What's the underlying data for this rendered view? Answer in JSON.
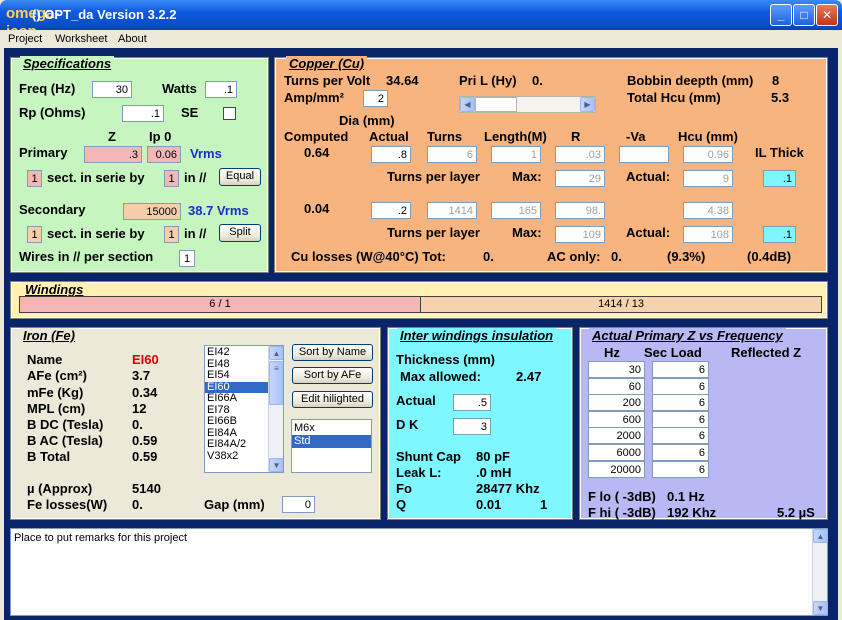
{
  "window": {
    "title": "()  OPT_da Version 3.2.2",
    "icon": "omega-icon",
    "min": "_",
    "max": "□",
    "close": "✕"
  },
  "menu": [
    "Project",
    "Worksheet",
    "About"
  ],
  "spec": {
    "title": "Specifications",
    "freq_label": "Freq (Hz)",
    "freq": "30",
    "watts_label": "Watts",
    "watts": ".1",
    "rp_label": "Rp (Ohms)",
    "rp": ".1",
    "se_label": "SE",
    "z_label": "Z",
    "ip0_label": "Ip 0",
    "primary_label": "Primary",
    "primary_z": ".3",
    "primary_ip": "0.06",
    "primary_vrms": "Vrms",
    "p_sect": "1",
    "sect_text": "sect. in serie by",
    "p_par": "1",
    "in_par": "in //",
    "equal": "Equal",
    "secondary_label": "Secondary",
    "secondary_z": "15000",
    "secondary_vrms": "38.7 Vrms",
    "s_sect": "1",
    "s_par": "1",
    "split": "Split",
    "wires_label": "Wires in // per section",
    "wires": "1"
  },
  "copper": {
    "title": "Copper (Cu)",
    "tpv_label": "Turns per Volt",
    "tpv": "34.64",
    "pril_label": "Pri L (Hy)",
    "pril": "0.",
    "bobbin_label": "Bobbin deepth (mm)",
    "bobbin": "8",
    "amp_label": "Amp/mm²",
    "amp": "2",
    "hcu_total_label": "Total Hcu (mm)",
    "hcu_total": "5.3",
    "dia_label": "Dia (mm)",
    "h_computed": "Computed",
    "h_actual": "Actual",
    "h_turns": "Turns",
    "h_length": "Length(M)",
    "h_r": "R",
    "h_va": "-Va",
    "h_hcu": "Hcu (mm)",
    "h_il": "IL Thick",
    "p_computed": "0.64",
    "p_actual": ".8",
    "p_turns": "6",
    "p_length": "1",
    "p_r": ".03",
    "p_va": "",
    "p_hcu": "0.96",
    "tpl_label": "Turns per layer",
    "max_label": "Max:",
    "actual_label": "Actual:",
    "p_max": "29",
    "p_act": "9",
    "p_il": ".1",
    "s_computed": "0.04",
    "s_actual": ".2",
    "s_turns": "1414",
    "s_length": "165",
    "s_r": "98.",
    "s_hcu": "4.38",
    "s_max": "109",
    "s_act": "108",
    "s_il": ".1",
    "losses_label": "Cu losses (W@40°C) Tot:",
    "losses_tot": "0.",
    "ac_label": "AC only:",
    "ac": "0.",
    "pct": "(9.3%)",
    "db": "(0.4dB)"
  },
  "windings": {
    "title": "Windings",
    "primary": "6 / 1",
    "secondary": "1414 / 13"
  },
  "iron": {
    "title": "Iron (Fe)",
    "rows": [
      {
        "label": "Name",
        "value": "EI60"
      },
      {
        "label": "AFe (cm²)",
        "value": "3.7"
      },
      {
        "label": "mFe (Kg)",
        "value": "0.34"
      },
      {
        "label": "MPL (cm)",
        "value": "12"
      },
      {
        "label": "B DC (Tesla)",
        "value": "0."
      },
      {
        "label": "B AC (Tesla)",
        "value": "0.59"
      },
      {
        "label": "B Total",
        "value": "0.59"
      }
    ],
    "mu_label": "µ (Approx)",
    "mu": "5140",
    "fe_label": "Fe losses(W)",
    "fe": "0.",
    "gap_label": "Gap (mm)",
    "gap": "0",
    "cores": [
      "EI42",
      "EI48",
      "EI54",
      "EI60",
      "EI66A",
      "EI78",
      "EI66B",
      "EI84A",
      "EI84A/2",
      "V38x2"
    ],
    "core_selected": 3,
    "btn_name": "Sort by Name",
    "btn_afe": "Sort by AFe",
    "btn_edit": "Edit hilighted",
    "grades": [
      "M6x",
      "Std"
    ],
    "grade_selected": 1
  },
  "insulation": {
    "title": "Inter windings insulation",
    "thick_label": "Thickness (mm)",
    "max_label": "Max allowed:",
    "max": "2.47",
    "actual_label": "Actual",
    "actual": ".5",
    "dk_label": "D K",
    "dk": "3",
    "shunt_label": "Shunt Cap",
    "shunt": "80 pF",
    "leak_label": "Leak L:",
    "leak": ".0 mH",
    "fo_label": "Fo",
    "fo": "28477 Khz",
    "q_label": "Q",
    "q": "0.01",
    "q2": "1"
  },
  "zfreq": {
    "title": "Actual Primary Z vs Frequency",
    "h_hz": "Hz",
    "h_load": "Sec Load",
    "h_refl": "Reflected Z",
    "hz": [
      "30",
      "60",
      "200",
      "600",
      "2000",
      "6000",
      "20000"
    ],
    "load": [
      "6",
      "6",
      "6",
      "6",
      "6",
      "6",
      "6"
    ],
    "flo_label": "F lo ( -3dB)",
    "flo": "0.1 Hz",
    "fhi_label": "F hi ( -3dB)",
    "fhi": "192 Khz",
    "rise": "5.2 µS"
  },
  "remarks": {
    "placeholder": "Place to put remarks for this project"
  },
  "colors": {
    "spec": "#c6f5c0",
    "copper": "#f8b47e",
    "windings": "#fff0b4",
    "iron": "#ece9d8",
    "insul": "#7ff7ff",
    "zfreq": "#b8b8f4"
  }
}
